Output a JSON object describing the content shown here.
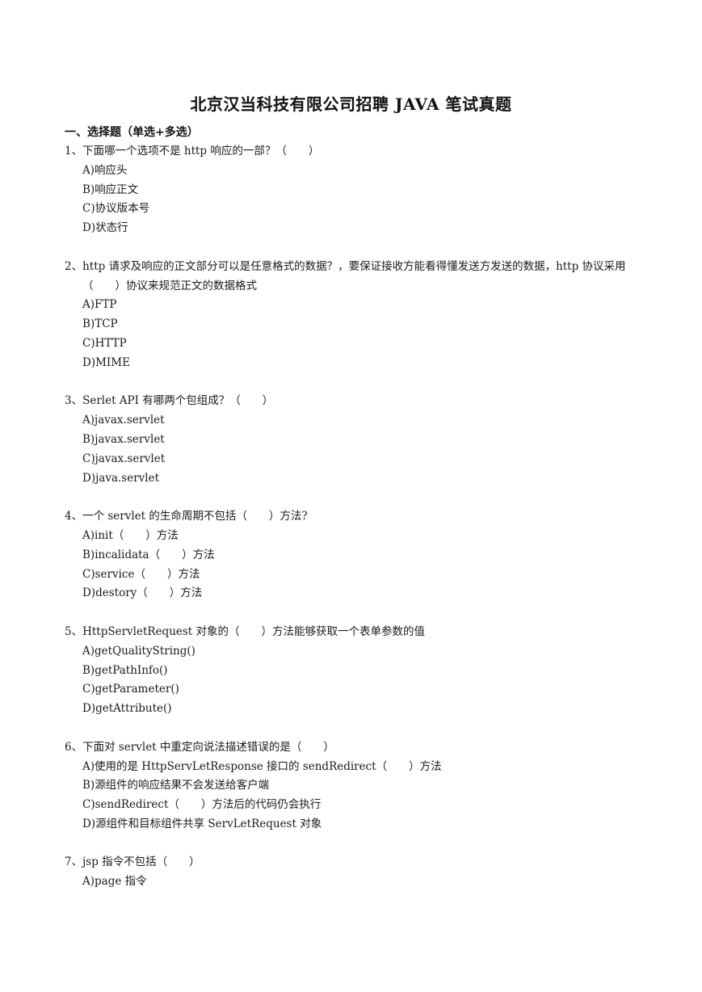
{
  "document": {
    "title": "北京汉当科技有限公司招聘 JAVA 笔试真题",
    "section_heading": "一、选择题（单选+多选）",
    "questions": [
      {
        "stem": "1、下面哪一个选项不是 http 响应的一部？（　　）",
        "options": [
          "A)响应头",
          "B)响应正文",
          "C)协议版本号",
          "D)状态行"
        ]
      },
      {
        "stem": "2、http 请求及响应的正文部分可以是任意格式的数据？，要保证接收方能看得懂发送方发送的数据，http 协议采用（　　）协议来规范正文的数据格式",
        "options": [
          "A)FTP",
          "B)TCP",
          "C)HTTP",
          "D)MIME"
        ]
      },
      {
        "stem": "3、Serlet API 有哪两个包组成？（　　）",
        "options": [
          "A)javax.servlet",
          "B)javax.servlet",
          "C)javax.servlet",
          "D)java.servlet"
        ]
      },
      {
        "stem": "4、一个 servlet 的生命周期不包括（　　）方法?",
        "options": [
          "A)init（　　）方法",
          "B)incalidata（　　）方法",
          "C)service（　　）方法",
          "D)destory（　　）方法"
        ]
      },
      {
        "stem": "5、HttpServletRequest 对象的（　　）方法能够获取一个表单参数的值",
        "options": [
          "A)getQualityString()",
          "B)getPathInfo()",
          "C)getParameter()",
          "D)getAttribute()"
        ]
      },
      {
        "stem": "6、下面对 servlet 中重定向说法描述错误的是（　　）",
        "options": [
          "A)使用的是 HttpServLetResponse 接口的 sendRedirect（　　）方法",
          "B)源组件的响应结果不会发送给客户端",
          "C)sendRedirect（　　）方法后的代码仍会执行",
          "D)源组件和目标组件共享 ServLetRequest 对象"
        ]
      },
      {
        "stem": "7、jsp 指令不包括（　　）",
        "options": [
          "A)page 指令"
        ]
      }
    ]
  }
}
